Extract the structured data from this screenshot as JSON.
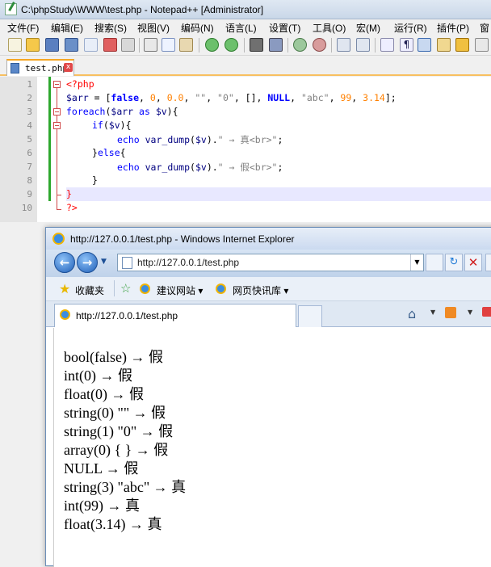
{
  "npp": {
    "title": "C:\\phpStudy\\WWW\\test.php - Notepad++ [Administrator]",
    "menu": [
      "文件(F)",
      "编辑(E)",
      "搜索(S)",
      "视图(V)",
      "编码(N)",
      "语言(L)",
      "设置(T)",
      "工具(O)",
      "宏(M)",
      "运行(R)",
      "插件(P)",
      "窗"
    ],
    "tab_label": "test.php",
    "tab_close": "x",
    "line_numbers": [
      "1",
      "2",
      "3",
      "4",
      "5",
      "6",
      "7",
      "8",
      "9",
      "10"
    ],
    "code": {
      "l1_tag": "<?php",
      "l2_var": "$arr",
      "l2_a": " = [",
      "l2_false": "false",
      "l2_c1": ", ",
      "l2_n0": "0",
      "l2_c2": ", ",
      "l2_n00": "0.0",
      "l2_c3": ", ",
      "l2_s1": "\"\"",
      "l2_c4": ", ",
      "l2_s2": "\"0\"",
      "l2_c5": ", [], ",
      "l2_null": "NULL",
      "l2_c6": ", ",
      "l2_s3": "\"abc\"",
      "l2_c7": ", ",
      "l2_n99": "99",
      "l2_c8": ", ",
      "l2_n314": "3.14",
      "l2_end": "];",
      "l3_kw": "foreach",
      "l3_a": "(",
      "l3_v1": "$arr",
      "l3_as": " as ",
      "l3_v2": "$v",
      "l3_b": "){",
      "l4_kw": "if",
      "l4_a": "(",
      "l4_v": "$v",
      "l4_b": "){",
      "l5_echo": "echo",
      "l5_fn": " var_dump",
      "l5_a": "(",
      "l5_v": "$v",
      "l5_b": ").",
      "l5_s": "\" → 真<br>\"",
      "l5_end": ";",
      "l6_a": "}",
      "l6_kw": "else",
      "l6_b": "{",
      "l7_echo": "echo",
      "l7_fn": " var_dump",
      "l7_a": "(",
      "l7_v": "$v",
      "l7_b": ").",
      "l7_s": "\" → 假<br>\"",
      "l7_end": ";",
      "l8": "}",
      "l9": "}",
      "l10": "?>"
    }
  },
  "ie": {
    "title": "http://127.0.0.1/test.php - Windows Internet Explorer",
    "address": "http://127.0.0.1/test.php",
    "fav_label": "收藏夹",
    "fav_item1": "建议网站 ▾",
    "fav_item2": "网页快讯库 ▾",
    "tab_title": "http://127.0.0.1/test.php",
    "output": [
      "bool(false) → 假",
      "int(0) → 假",
      "float(0) → 假",
      "string(0) \"\" → 假",
      "string(1) \"0\" → 假",
      "array(0) { } → 假",
      "NULL → 假",
      "string(3) \"abc\" → 真",
      "int(99) → 真",
      "float(3.14) → 真"
    ]
  }
}
